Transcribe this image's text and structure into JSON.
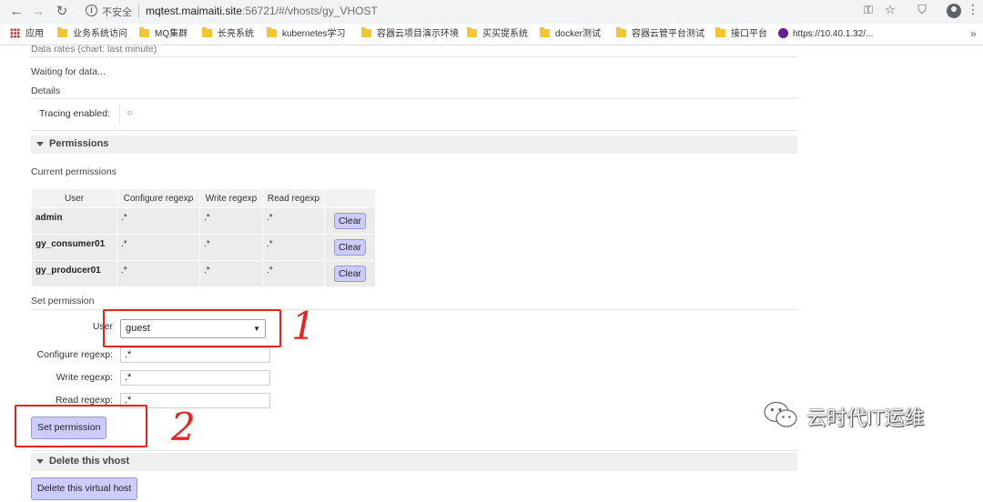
{
  "browser": {
    "security_label": "不安全",
    "url_host": "mqtest.maimaiti.site",
    "url_rest": ":56721/#/vhosts/gy_VHOST",
    "bookmarks": [
      "应用",
      "业务系统访问",
      "MQ集群",
      "长亮系统",
      "kubernetes学习",
      "容器云项目演示环境",
      "买买提系统",
      "docker测试",
      "容器云管平台测试",
      "接口平台",
      "https://10.40.1.32/..."
    ]
  },
  "page": {
    "data_rates_label": "Data rates (chart: last minute)",
    "waiting_text": "Waiting for data...",
    "details_label": "Details",
    "tracing_label": "Tracing enabled:",
    "tracing_value": "○",
    "permissions_section": "Permissions",
    "current_permissions_label": "Current permissions",
    "table": {
      "headers": [
        "User",
        "Configure regexp",
        "Write regexp",
        "Read regexp"
      ],
      "rows": [
        {
          "user": "admin",
          "configure": ".*",
          "write": ".*",
          "read": ".*",
          "action": "Clear"
        },
        {
          "user": "gy_consumer01",
          "configure": ".*",
          "write": ".*",
          "read": ".*",
          "action": "Clear"
        },
        {
          "user": "gy_producer01",
          "configure": ".*",
          "write": ".*",
          "read": ".*",
          "action": "Clear"
        }
      ]
    },
    "set_permission_label": "Set permission",
    "form": {
      "user_label": "User",
      "user_value": "guest",
      "configure_label": "Configure regexp:",
      "configure_value": ".*",
      "write_label": "Write regexp:",
      "write_value": ".*",
      "read_label": "Read regexp:",
      "read_value": ".*",
      "submit_label": "Set permission"
    },
    "delete_section": "Delete this vhost",
    "delete_button": "Delete this virtual host"
  },
  "annotations": {
    "step1": "1",
    "step2": "2",
    "color": "#e8231e"
  },
  "watermark": {
    "text": "云时代IT运维"
  }
}
